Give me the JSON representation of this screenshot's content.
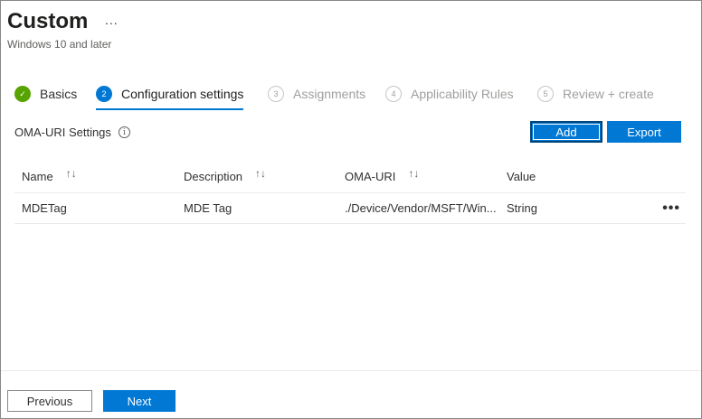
{
  "header": {
    "title": "Custom",
    "more_label": "...",
    "subtitle": "Windows 10 and later"
  },
  "steps": [
    {
      "number": "✓",
      "label": "Basics",
      "state": "done"
    },
    {
      "number": "2",
      "label": "Configuration settings",
      "state": "active"
    },
    {
      "number": "3",
      "label": "Assignments",
      "state": "todo"
    },
    {
      "number": "4",
      "label": "Applicability Rules",
      "state": "todo"
    },
    {
      "number": "5",
      "label": "Review + create",
      "state": "todo"
    }
  ],
  "section": {
    "label": "OMA-URI Settings",
    "info_icon": "i"
  },
  "toolbar": {
    "add_label": "Add",
    "export_label": "Export"
  },
  "table": {
    "columns": [
      "Name",
      "Description",
      "OMA-URI",
      "Value"
    ],
    "sort_glyph": "↑↓",
    "rows": [
      {
        "name": "MDETag",
        "description": "MDE Tag",
        "oma_uri": "./Device/Vendor/MSFT/Win...",
        "value": "String",
        "more": "•••"
      }
    ]
  },
  "footer": {
    "previous_label": "Previous",
    "next_label": "Next"
  },
  "colors": {
    "accent": "#0078d4",
    "success": "#57a300"
  },
  "icons": {
    "basics_step": "checkmark-icon",
    "info": "info-icon",
    "sort": "sort-icon",
    "row_more": "more-options-icon"
  }
}
